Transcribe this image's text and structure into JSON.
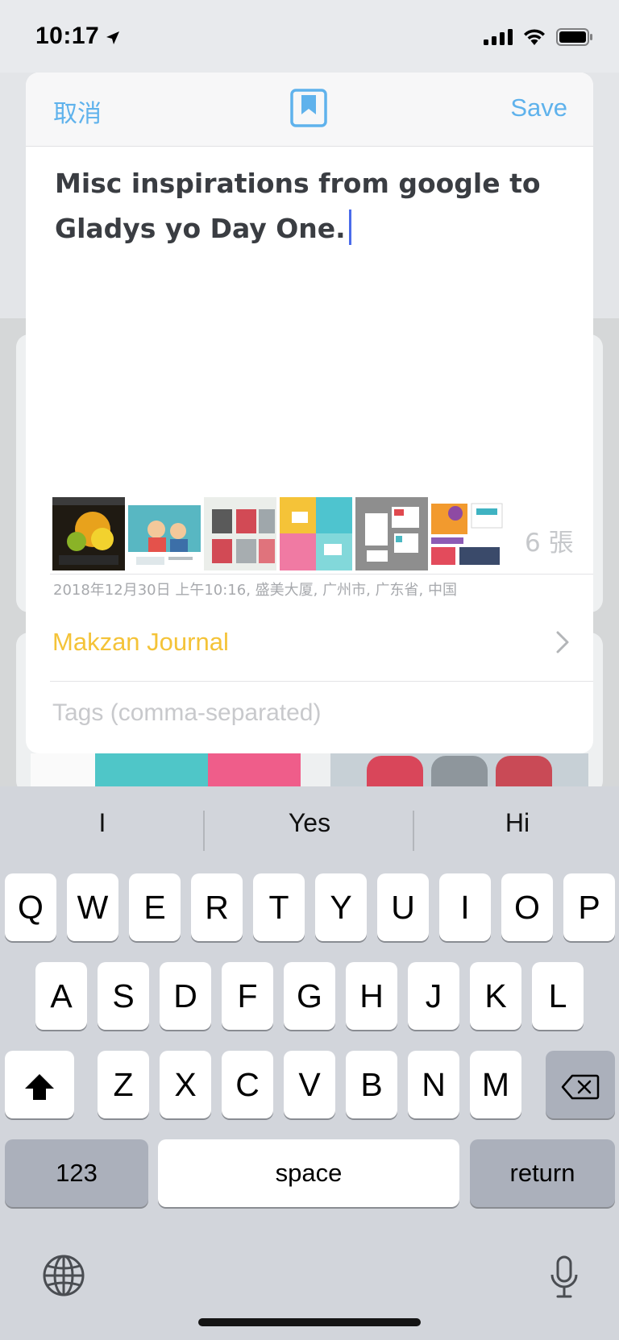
{
  "status_bar": {
    "time": "10:17"
  },
  "sheet": {
    "cancel_label": "取消",
    "save_label": "Save",
    "entry_text_line1": "Misc inspirations from google to",
    "entry_text_line2": "Gladys yo Day One.",
    "photo_count": "6 張",
    "meta": "2018年12月30日 上午10:16, 盛美大厦, 广州市, 广东省, 中国",
    "journal_name": "Makzan Journal",
    "tags_placeholder": "Tags (comma-separated)"
  },
  "keyboard": {
    "suggestions": [
      "I",
      "Yes",
      "Hi"
    ],
    "row1": [
      "Q",
      "W",
      "E",
      "R",
      "T",
      "Y",
      "U",
      "I",
      "O",
      "P"
    ],
    "row2": [
      "A",
      "S",
      "D",
      "F",
      "G",
      "H",
      "J",
      "K",
      "L"
    ],
    "row3": [
      "Z",
      "X",
      "C",
      "V",
      "B",
      "N",
      "M"
    ],
    "numbers_label": "123",
    "space_label": "space",
    "return_label": "return"
  },
  "colors": {
    "accent_blue": "#5fb2ec",
    "journal_yellow": "#f4c338",
    "caret_blue": "#4a6bea"
  }
}
